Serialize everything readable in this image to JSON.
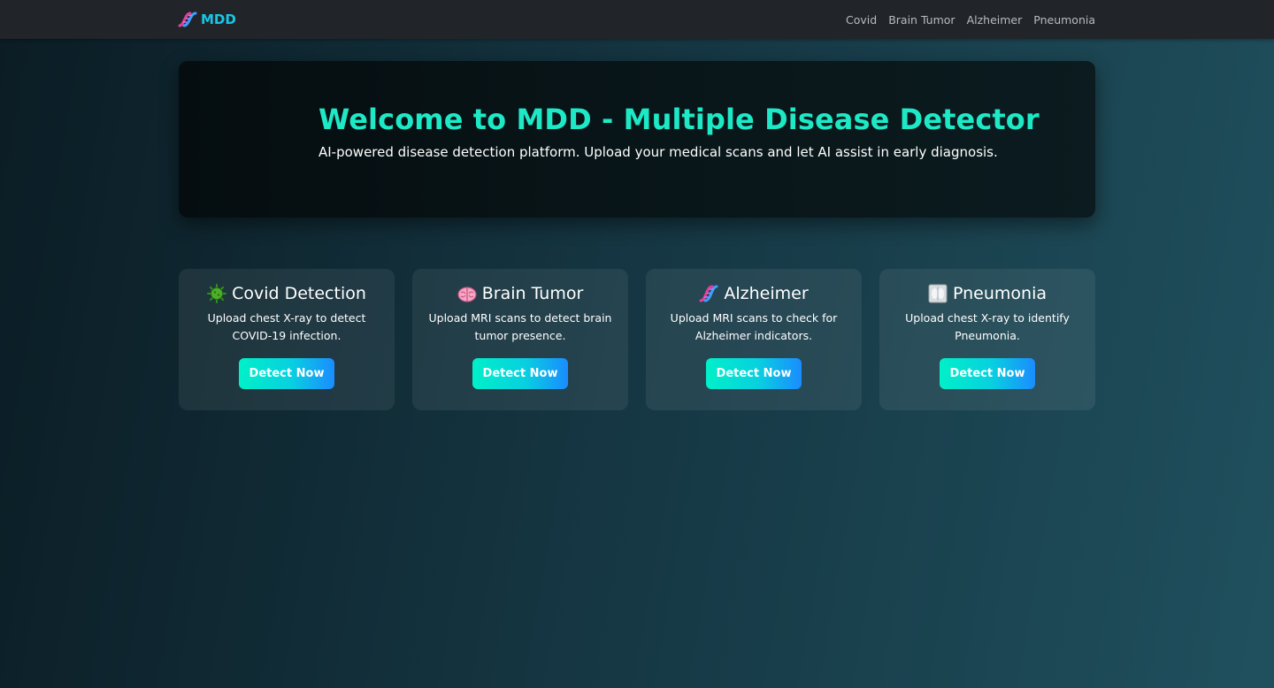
{
  "navbar": {
    "brand": {
      "icon": "dna-icon",
      "label": "MDD"
    },
    "links": [
      "Covid",
      "Brain Tumor",
      "Alzheimer",
      "Pneumonia"
    ]
  },
  "hero": {
    "title": "Welcome to MDD - Multiple Disease Detector",
    "subtitle": "AI-powered disease detection platform. Upload your medical scans and let AI assist in early diagnosis."
  },
  "cards": [
    {
      "icon": "virus-icon",
      "title": "Covid Detection",
      "description": "Upload chest X-ray to detect COVID-19 infection.",
      "button": "Detect Now"
    },
    {
      "icon": "brain-icon",
      "title": "Brain Tumor",
      "description": "Upload MRI scans to detect brain tumor presence.",
      "button": "Detect Now"
    },
    {
      "icon": "dna-icon",
      "title": "Alzheimer",
      "description": "Upload MRI scans to check for Alzheimer indicators.",
      "button": "Detect Now"
    },
    {
      "icon": "xray-icon",
      "title": "Pneumonia",
      "description": "Upload chest X-ray to identify Pneumonia.",
      "button": "Detect Now"
    }
  ],
  "colors": {
    "accent": "#1de9c6",
    "brand": "#17c7e6",
    "navbar_bg": "#212529"
  }
}
